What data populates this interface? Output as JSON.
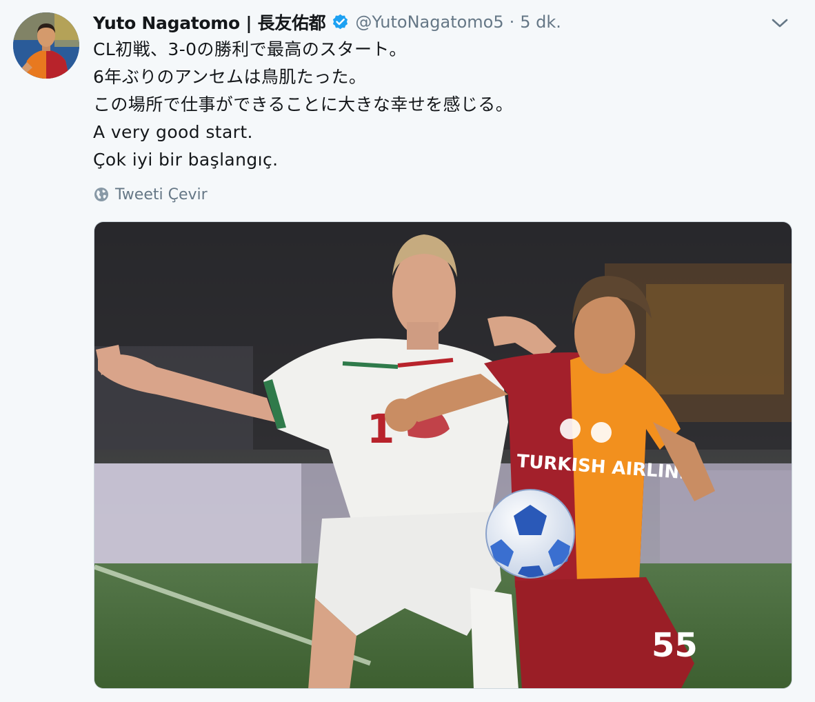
{
  "author": {
    "display_name": "Yuto Nagatomo | 長友佑都",
    "handle": "@YutoNagatomo5",
    "timestamp": "5 dk.",
    "verified": true,
    "avatar_icon": "profile-photo"
  },
  "tweet": {
    "lines": [
      "CL初戦、3-0の勝利で最高のスタート。",
      "6年ぶりのアンセムは鳥肌たった。",
      "この場所で仕事ができることに大きな幸せを感じる。",
      "A very good start.",
      "Çok iyi bir başlangıç."
    ],
    "translate_label": "Tweeti Çevir",
    "translate_icon": "globe-icon"
  },
  "media": {
    "sponsor_text": "TURKISH AIRLINES",
    "left_shirt_number": "1",
    "right_shirt_number": "55"
  },
  "colors": {
    "verified_blue": "#1da1f2",
    "text_primary": "#14171a",
    "text_secondary": "#657786",
    "galatasaray_red": "#a3202b",
    "galatasaray_orange": "#f2901e"
  }
}
